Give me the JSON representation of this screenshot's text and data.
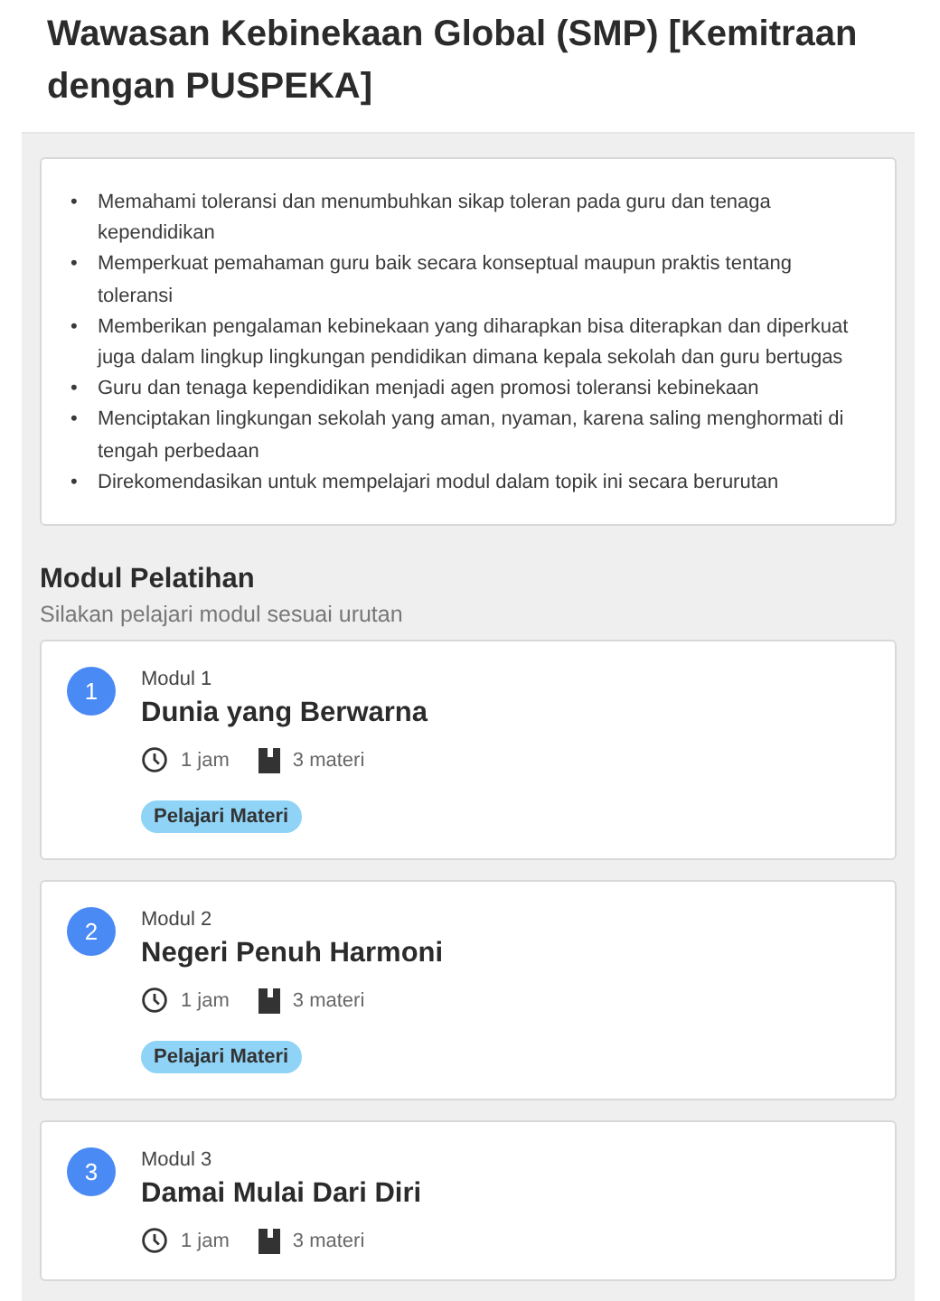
{
  "title": "Wawasan Kebinekaan Global (SMP) [Kemitraan dengan PUSPEKA]",
  "objectives": [
    {
      "marker": "•",
      "text": "Memahami toleransi dan menumbuhkan sikap toleran pada guru dan tenaga kependidikan"
    },
    {
      "marker": "•",
      "text": "Memperkuat pemahaman guru baik secara konseptual maupun praktis tentang toleransi"
    },
    {
      "marker": "•",
      "text": "Memberikan pengalaman kebinekaan yang diharapkan bisa diterapkan dan diperkuat juga dalam lingkup lingkungan pendidikan dimana kepala sekolah dan guru bertugas"
    },
    {
      "marker": "•",
      "text": "Guru dan tenaga kependidikan menjadi agen promosi toleransi kebinekaan"
    },
    {
      "marker": "•",
      "text": "Menciptakan lingkungan sekolah yang aman, nyaman, karena saling menghormati di tengah perbedaan"
    },
    {
      "marker": "•",
      "text": "Direkomendasikan untuk mempelajari modul dalam topik ini secara berurutan"
    }
  ],
  "section": {
    "heading": "Modul Pelatihan",
    "subheading": "Silakan pelajari modul sesuai urutan"
  },
  "modules": [
    {
      "number": "1",
      "label": "Modul 1",
      "name": "Dunia yang Berwarna",
      "duration": "1 jam",
      "materials": "3 materi",
      "button": "Pelajari Materi"
    },
    {
      "number": "2",
      "label": "Modul 2",
      "name": "Negeri Penuh Harmoni",
      "duration": "1 jam",
      "materials": "3 materi",
      "button": "Pelajari Materi"
    },
    {
      "number": "3",
      "label": "Modul 3",
      "name": "Damai Mulai Dari Diri",
      "duration": "1 jam",
      "materials": "3 materi"
    }
  ]
}
